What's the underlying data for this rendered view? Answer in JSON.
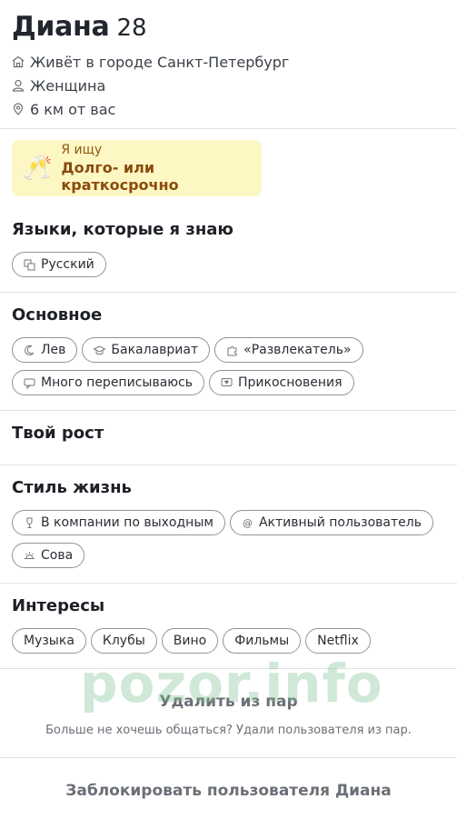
{
  "profile": {
    "name": "Диана",
    "age": "28",
    "city": "Живёт в городе Санкт-Петербург",
    "gender": "Женщина",
    "distance": "6 км от вас"
  },
  "seeking": {
    "label": "Я ищу",
    "value": "Долго- или краткосрочно",
    "icon": "champagne-glasses-icon"
  },
  "sections": {
    "languages": {
      "title": "Языки, которые я знаю",
      "chips": [
        "Русский"
      ]
    },
    "basics": {
      "title": "Основное",
      "chips": [
        "Лев",
        "Бакалавриат",
        "«Развлекатель»",
        "Много переписываюсь",
        "Прикосновения"
      ]
    },
    "height": {
      "title": "Твой рост"
    },
    "lifestyle": {
      "title": "Стиль жизнь",
      "chips": [
        "В компании по выходным",
        "Активный пользователь",
        "Сова"
      ]
    },
    "interests": {
      "title": "Интересы",
      "chips": [
        "Музыка",
        "Клубы",
        "Вино",
        "Фильмы",
        "Netflix"
      ]
    }
  },
  "unmatch": {
    "title": "Удалить из пар",
    "description": "Больше не хочешь общаться? Удали пользователя из пар."
  },
  "block": {
    "title": "Заблокировать пользователя Диана"
  },
  "watermark": "pozor.info"
}
